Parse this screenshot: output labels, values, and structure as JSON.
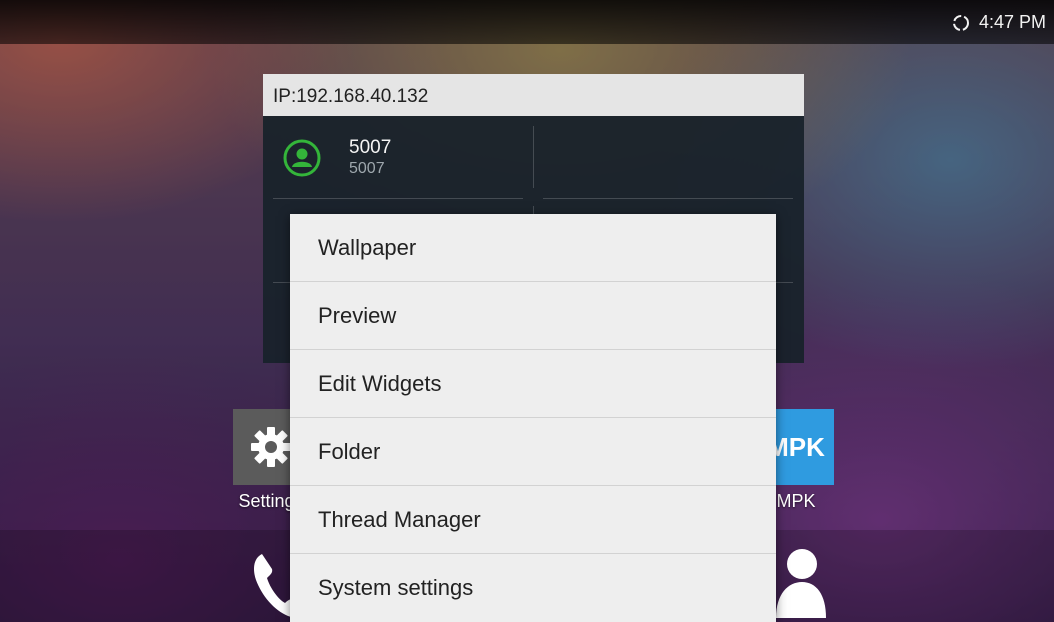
{
  "status_bar": {
    "icon": "sync-icon",
    "time": "4:47 PM"
  },
  "widget": {
    "header": "IP:192.168.40.132",
    "account": {
      "icon": "user-avatar-icon",
      "status_color": "#34b53a",
      "name": "5007",
      "number": "5007"
    }
  },
  "apps": [
    {
      "label": "Settings",
      "icon": "gear-icon"
    },
    {
      "label": "MPK",
      "icon_text": "MPK"
    }
  ],
  "dock": [
    {
      "icon": "phone-icon"
    },
    {
      "icon": "contacts-icon"
    }
  ],
  "context_menu": {
    "items": [
      {
        "label": "Wallpaper"
      },
      {
        "label": "Preview"
      },
      {
        "label": "Edit Widgets"
      },
      {
        "label": "Folder"
      },
      {
        "label": "Thread Manager"
      },
      {
        "label": "System settings"
      }
    ]
  },
  "colors": {
    "mpk_blue": "#2f9be0",
    "menu_background": "#eeeeee"
  }
}
